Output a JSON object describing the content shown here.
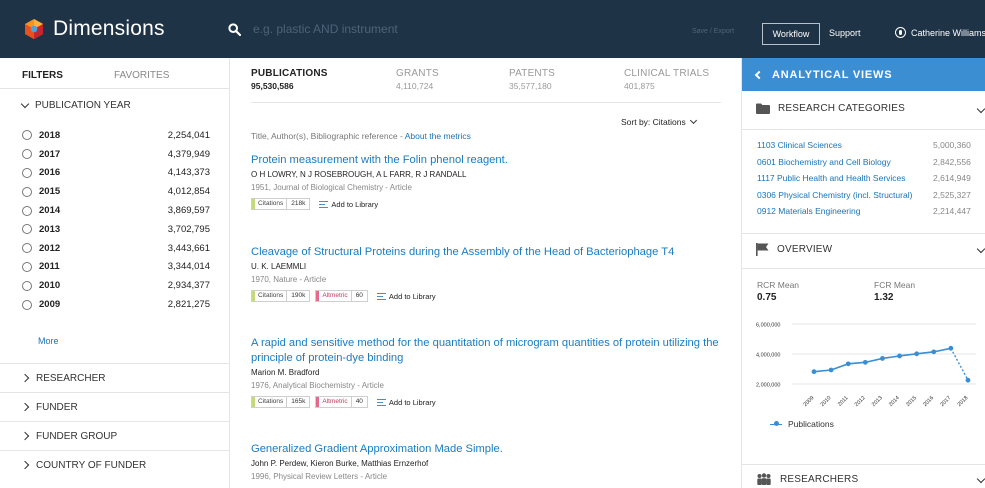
{
  "app": {
    "name": "Dimensions",
    "search_placeholder": "e.g. plastic AND instrument",
    "save_export": "Save / Export",
    "workflow": "Workflow",
    "support": "Support",
    "user_name": "Catherine Williams"
  },
  "sidebar": {
    "tab_filters": "FILTERS",
    "tab_favorites": "FAVORITES",
    "publication_year_label": "PUBLICATION YEAR",
    "years": [
      {
        "year": "2018",
        "count": "2,254,041"
      },
      {
        "year": "2017",
        "count": "4,379,949"
      },
      {
        "year": "2016",
        "count": "4,143,373"
      },
      {
        "year": "2015",
        "count": "4,012,854"
      },
      {
        "year": "2014",
        "count": "3,869,597"
      },
      {
        "year": "2013",
        "count": "3,702,795"
      },
      {
        "year": "2012",
        "count": "3,443,661"
      },
      {
        "year": "2011",
        "count": "3,344,014"
      },
      {
        "year": "2010",
        "count": "2,934,377"
      },
      {
        "year": "2009",
        "count": "2,821,275"
      }
    ],
    "more": "More",
    "collapsed": [
      "RESEARCHER",
      "FUNDER",
      "FUNDER GROUP",
      "COUNTRY OF FUNDER"
    ]
  },
  "main": {
    "tabs": [
      {
        "name": "PUBLICATIONS",
        "count": "95,530,586"
      },
      {
        "name": "GRANTS",
        "count": "4,110,724"
      },
      {
        "name": "PATENTS",
        "count": "35,577,180"
      },
      {
        "name": "CLINICAL TRIALS",
        "count": "401,875"
      }
    ],
    "sort_label": "Sort by: Citations",
    "meta_hint": "Title, Author(s), Bibliographic reference - ",
    "meta_hint_link": "About the metrics",
    "add_to_library": "Add to Library",
    "citations_label": "Citations",
    "altmetric_label": "Altmetric",
    "publications": [
      {
        "title": "Protein measurement with the Folin phenol reagent.",
        "authors": "O H LOWRY, N J ROSEBROUGH, A L FARR, R J RANDALL",
        "meta": "1951, Journal of Biological Chemistry - Article",
        "citations": "218k",
        "altmetric": ""
      },
      {
        "title": "Cleavage of Structural Proteins during the Assembly of the Head of Bacteriophage T4",
        "authors": "U. K. LAEMMLI",
        "meta": "1970, Nature - Article",
        "citations": "190k",
        "altmetric": "60"
      },
      {
        "title": "A rapid and sensitive method for the quantitation of microgram quantities of protein utilizing the principle of protein-dye binding",
        "authors": "Marion M. Bradford",
        "meta": "1976, Analytical Biochemistry - Article",
        "citations": "165k",
        "altmetric": "40"
      },
      {
        "title": "Generalized Gradient Approximation Made Simple.",
        "authors": "John P. Perdew, Kieron Burke, Matthias Ernzerhof",
        "meta": "1996, Physical Review Letters - Article",
        "citations": "",
        "altmetric": ""
      }
    ]
  },
  "right_panel": {
    "title": "ANALYTICAL VIEWS",
    "research_categories_label": "RESEARCH CATEGORIES",
    "categories": [
      {
        "name": "1103 Clinical Sciences",
        "value": "5,000,360"
      },
      {
        "name": "0601 Biochemistry and Cell Biology",
        "value": "2,842,556"
      },
      {
        "name": "1117 Public Health and Health Services",
        "value": "2,614,949"
      },
      {
        "name": "0306 Physical Chemistry (incl. Structural)",
        "value": "2,525,327"
      },
      {
        "name": "0912 Materials Engineering",
        "value": "2,214,447"
      }
    ],
    "overview_label": "OVERVIEW",
    "rcr_label": "RCR Mean",
    "rcr_value": "0.75",
    "fcr_label": "FCR Mean",
    "fcr_value": "1.32",
    "researchers_label": "RESEARCHERS",
    "accent_color": "#3c8ed3"
  },
  "chart_data": {
    "type": "line",
    "x": [
      "2009",
      "2010",
      "2011",
      "2012",
      "2013",
      "2014",
      "2015",
      "2016",
      "2017",
      "2018"
    ],
    "y_ticks": [
      "6,000,000",
      "4,000,000",
      "2,000,000"
    ],
    "ylim": [
      2000000,
      6000000
    ],
    "series": [
      {
        "name": "Publications",
        "values": [
          2821275,
          2934377,
          3344014,
          3443661,
          3702795,
          3869597,
          4012854,
          4143373,
          4379949,
          2254041
        ]
      }
    ],
    "grid": true,
    "legend": "bottom-left"
  }
}
